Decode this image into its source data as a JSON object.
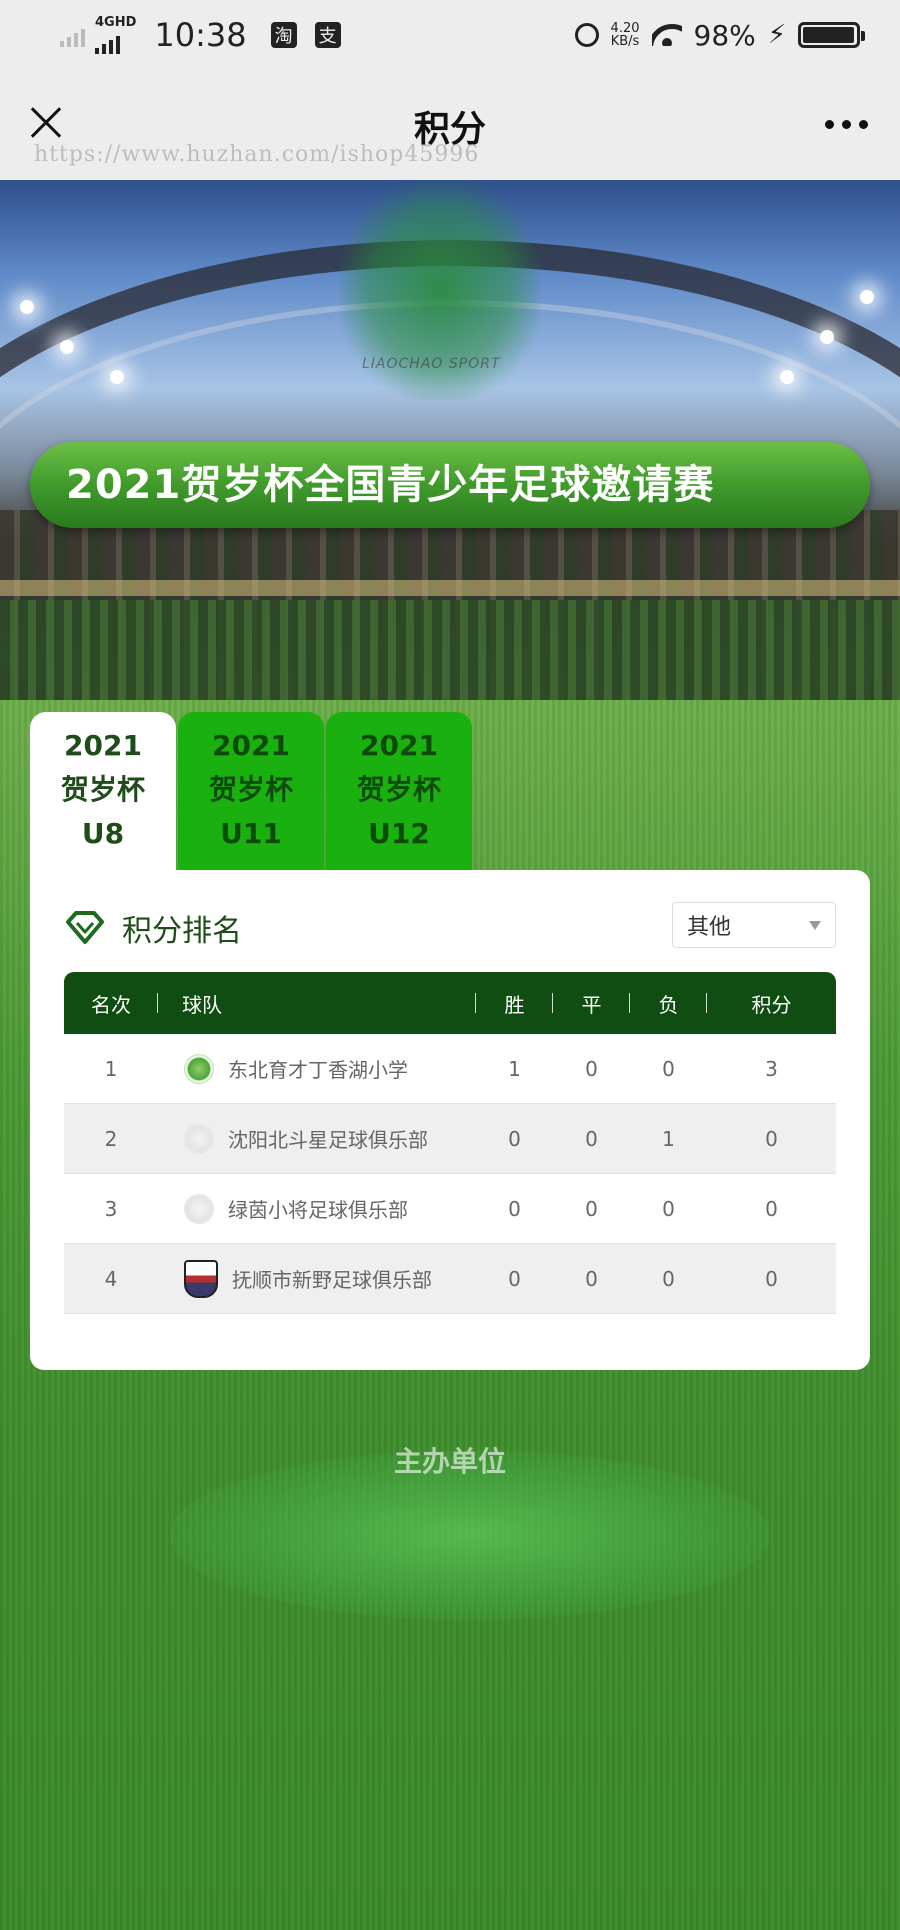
{
  "status_bar": {
    "network": "4GHD",
    "time": "10:38",
    "apps": [
      "淘",
      "支"
    ],
    "speed_value": "4.20",
    "speed_unit": "KB/s",
    "battery_pct": "98%",
    "battery_level": 0.98
  },
  "nav": {
    "title": "积分",
    "watermark_url": "https://www.huzhan.com/ishop45996"
  },
  "hero": {
    "logo_text": "LIAOCHAO SPORT",
    "banner_title": "2021贺岁杯全国青少年足球邀请赛"
  },
  "tabs": [
    {
      "line1": "2021",
      "line2": "贺岁杯",
      "line3": "U8",
      "active": true
    },
    {
      "line1": "2021",
      "line2": "贺岁杯",
      "line3": "U11",
      "active": false
    },
    {
      "line1": "2021",
      "line2": "贺岁杯",
      "line3": "U12",
      "active": false
    }
  ],
  "ranking": {
    "title": "积分排名",
    "filter_value": "其他",
    "columns": [
      "名次",
      "球队",
      "胜",
      "平",
      "负",
      "积分"
    ],
    "rows": [
      {
        "rank": "1",
        "team": "东北育才丁香湖小学",
        "w": "1",
        "d": "0",
        "l": "0",
        "pts": "3",
        "badge": "green"
      },
      {
        "rank": "2",
        "team": "沈阳北斗星足球俱乐部",
        "w": "0",
        "d": "0",
        "l": "1",
        "pts": "0",
        "badge": "grey"
      },
      {
        "rank": "3",
        "team": "绿茵小将足球俱乐部",
        "w": "0",
        "d": "0",
        "l": "0",
        "pts": "0",
        "badge": "grey"
      },
      {
        "rank": "4",
        "team": "抚顺市新野足球俱乐部",
        "w": "0",
        "d": "0",
        "l": "0",
        "pts": "0",
        "badge": "shield"
      }
    ]
  },
  "sponsor": {
    "title": "主办单位"
  },
  "colors": {
    "header_green": "#0f4d12",
    "tab_green": "#1ab010",
    "banner_green": "#3f9a2b"
  }
}
